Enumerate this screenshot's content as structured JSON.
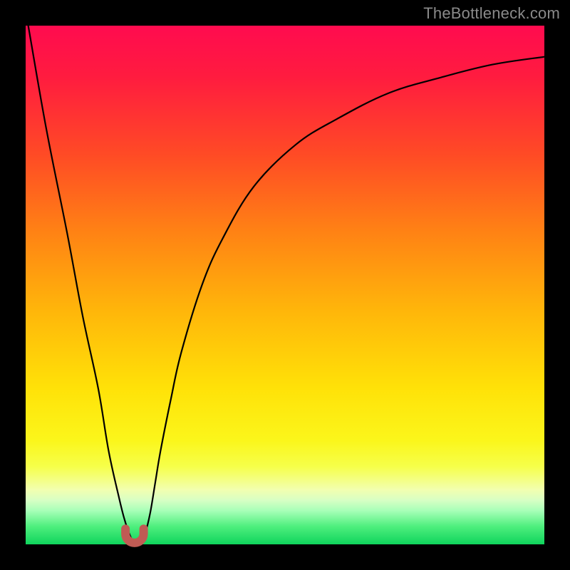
{
  "watermark": "TheBottleneck.com",
  "colors": {
    "frame": "#000000",
    "gradient_stops": [
      {
        "offset": 0.0,
        "color": "#ff0b4f"
      },
      {
        "offset": 0.1,
        "color": "#ff1c3f"
      },
      {
        "offset": 0.25,
        "color": "#ff4b25"
      },
      {
        "offset": 0.4,
        "color": "#ff8314"
      },
      {
        "offset": 0.55,
        "color": "#ffb60a"
      },
      {
        "offset": 0.7,
        "color": "#ffe208"
      },
      {
        "offset": 0.8,
        "color": "#fbf61b"
      },
      {
        "offset": 0.85,
        "color": "#f6ff4a"
      },
      {
        "offset": 0.895,
        "color": "#f2ffb0"
      },
      {
        "offset": 0.915,
        "color": "#d7ffc4"
      },
      {
        "offset": 0.935,
        "color": "#a8ffb8"
      },
      {
        "offset": 0.965,
        "color": "#4fef7e"
      },
      {
        "offset": 1.0,
        "color": "#0fd45c"
      }
    ],
    "curve": "#000000",
    "notch_stroke": "#c05b54",
    "notch_fill": "#c05b54"
  },
  "chart_data": {
    "type": "line",
    "title": "",
    "xlabel": "",
    "ylabel": "",
    "xlim": [
      0,
      100
    ],
    "ylim": [
      0,
      100
    ],
    "grid": false,
    "legend": false,
    "series": [
      {
        "name": "bottleneck-curve",
        "x": [
          0.5,
          4,
          8,
          11,
          14,
          16,
          18,
          19,
          20,
          21,
          22,
          23,
          24,
          25,
          26,
          28,
          30,
          34,
          38,
          44,
          52,
          60,
          70,
          80,
          90,
          100
        ],
        "values": [
          100,
          80,
          60,
          44,
          30,
          18,
          9,
          5,
          2,
          0,
          0,
          2,
          6,
          12,
          18,
          28,
          37,
          50,
          59,
          69,
          77,
          82,
          87,
          90,
          92.5,
          94
        ]
      }
    ],
    "annotations": [
      {
        "name": "u-notch",
        "x_center": 21,
        "width": 3.5,
        "y_center": 1.5,
        "note": "small rounded U marker at curve minimum"
      }
    ]
  }
}
